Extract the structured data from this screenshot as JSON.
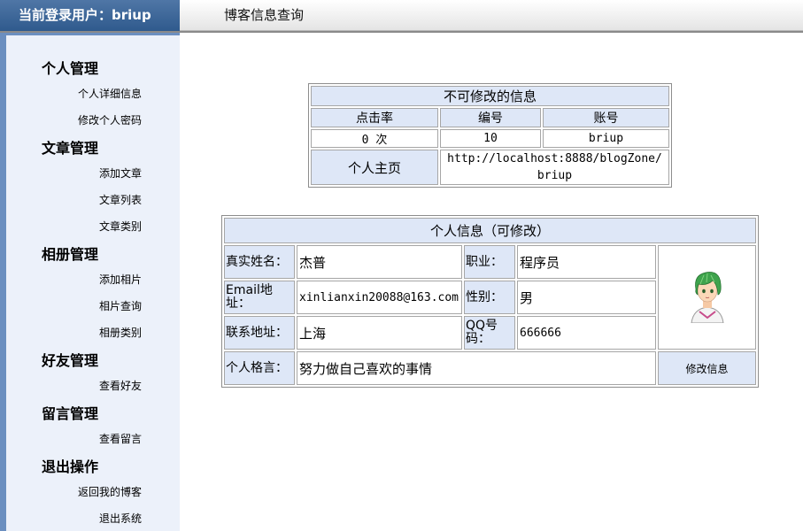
{
  "header": {
    "current_user": "当前登录用户：briup",
    "page_title": "博客信息查询"
  },
  "sidebar": {
    "groups": [
      {
        "title": "个人管理",
        "items": [
          "个人详细信息",
          "修改个人密码"
        ]
      },
      {
        "title": "文章管理",
        "items": [
          "添加文章",
          "文章列表",
          "文章类别"
        ]
      },
      {
        "title": "相册管理",
        "items": [
          "添加相片",
          "相片查询",
          "相册类别"
        ]
      },
      {
        "title": "好友管理",
        "items": [
          "查看好友"
        ]
      },
      {
        "title": "留言管理",
        "items": [
          "查看留言"
        ]
      },
      {
        "title": "退出操作",
        "items": [
          "返回我的博客",
          "退出系统"
        ]
      }
    ]
  },
  "readonly_info": {
    "title": "不可修改的信息",
    "columns": [
      "点击率",
      "编号",
      "账号"
    ],
    "values": [
      "0 次",
      "10",
      "briup"
    ],
    "homepage_label": "个人主页",
    "homepage_value": "http://localhost:8888/blogZone/briup"
  },
  "personal_info": {
    "title": "个人信息（可修改）",
    "real_name_label": "真实姓名：",
    "real_name": "杰普",
    "job_label": "职业：",
    "job": "程序员",
    "email_label": "Email地址：",
    "email": "xinlianxin20088@163.com",
    "gender_label": "性别：",
    "gender": "男",
    "address_label": "联系地址：",
    "address": "上海",
    "qq_label": "QQ号码：",
    "qq": "666666",
    "motto_label": "个人格言：",
    "motto": "努力做自己喜欢的事情",
    "edit_button": "修改信息",
    "avatar_icon": "green-hair-avatar"
  }
}
